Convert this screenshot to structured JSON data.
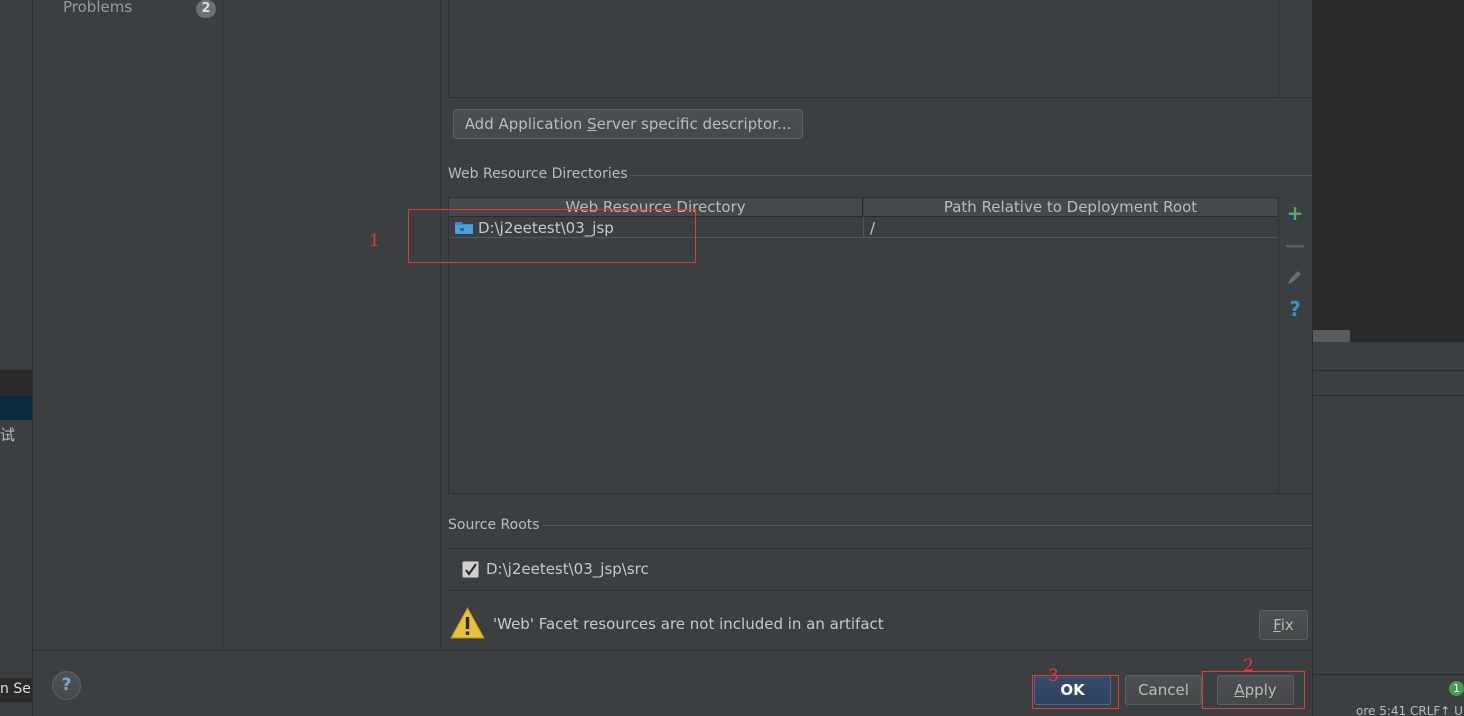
{
  "sidebar": {
    "problems_label": "Problems",
    "problems_count": "2"
  },
  "descriptors": {
    "add_button_prefix": "Add Application ",
    "add_button_mnemonic": "S",
    "add_button_suffix": "erver specific descriptor..."
  },
  "web_resource_directories": {
    "section_title": "Web Resource Directories",
    "columns": [
      "Web Resource Directory",
      "Path Relative to Deployment Root"
    ],
    "rows": [
      {
        "directory": "D:\\j2eetest\\03_jsp",
        "path": "/"
      }
    ],
    "toolbar_icons": [
      "add-icon",
      "remove-icon",
      "edit-icon",
      "help-icon"
    ]
  },
  "source_roots": {
    "section_title": "Source Roots",
    "items": [
      {
        "path": "D:\\j2eetest\\03_jsp\\src",
        "checked": true
      }
    ]
  },
  "warning": {
    "icon": "warning-icon",
    "text": "'Web' Facet resources are not included in an artifact",
    "fix_mnemonic": "F",
    "fix_rest": "ix"
  },
  "footer": {
    "help_label": "?",
    "ok_label": "OK",
    "cancel_label": "Cancel",
    "apply_mnemonic": "A",
    "apply_rest": "pply"
  },
  "annotations": [
    "1",
    "2",
    "3"
  ],
  "background": {
    "left_text": "试",
    "left_bottom_text": "n Se",
    "right_badge": "1",
    "right_status": "ore    5:41    CRLF↑  U"
  },
  "colors": {
    "dialog_bg": "#3c3f41",
    "accent_green": "#59a869",
    "help_blue": "#3592c4",
    "annotation_red": "#e53a3a",
    "ok_button": "#2f4361"
  }
}
